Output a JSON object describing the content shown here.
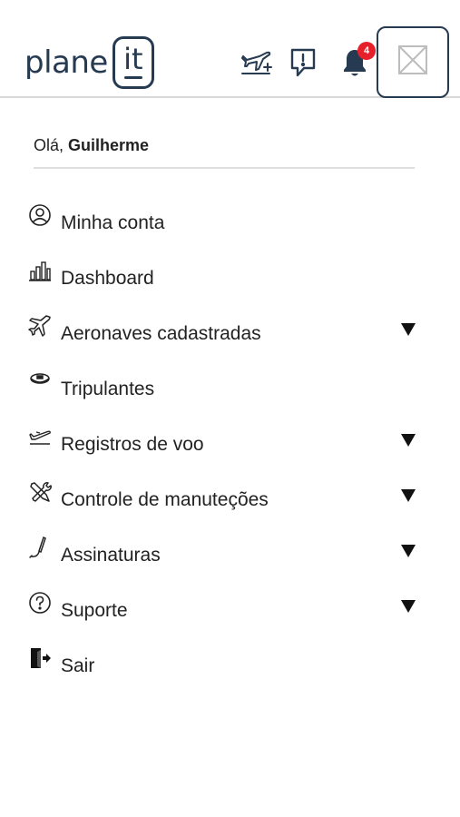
{
  "header": {
    "logo_word": "plane",
    "logo_box": "it",
    "icons": [
      "plane-add-icon",
      "report-icon",
      "bell-icon"
    ],
    "notification_count": "4",
    "close_icon": "close-icon"
  },
  "greeting": {
    "prefix": "Olá,",
    "name": "Guilherme"
  },
  "menu": {
    "items": [
      {
        "label": "Minha conta",
        "icon": "user-circle-icon",
        "has_submenu": false
      },
      {
        "label": "Dashboard",
        "icon": "bar-chart-icon",
        "has_submenu": false
      },
      {
        "label": "Aeronaves cadastradas",
        "icon": "airplane-icon",
        "has_submenu": true
      },
      {
        "label": "Tripulantes",
        "icon": "pilot-cap-icon",
        "has_submenu": false
      },
      {
        "label": "Registros de voo",
        "icon": "takeoff-icon",
        "has_submenu": true
      },
      {
        "label": "Controle de manuteções",
        "icon": "tools-icon",
        "has_submenu": true
      },
      {
        "label": "Assinaturas",
        "icon": "pen-icon",
        "has_submenu": true
      },
      {
        "label": "Suporte",
        "icon": "question-circle-icon",
        "has_submenu": true
      },
      {
        "label": "Sair",
        "icon": "logout-icon",
        "has_submenu": false
      }
    ]
  },
  "colors": {
    "brand_navy": "#263a52",
    "badge_red": "#e5202a",
    "text": "#222222",
    "divider": "#d9d9d9"
  }
}
